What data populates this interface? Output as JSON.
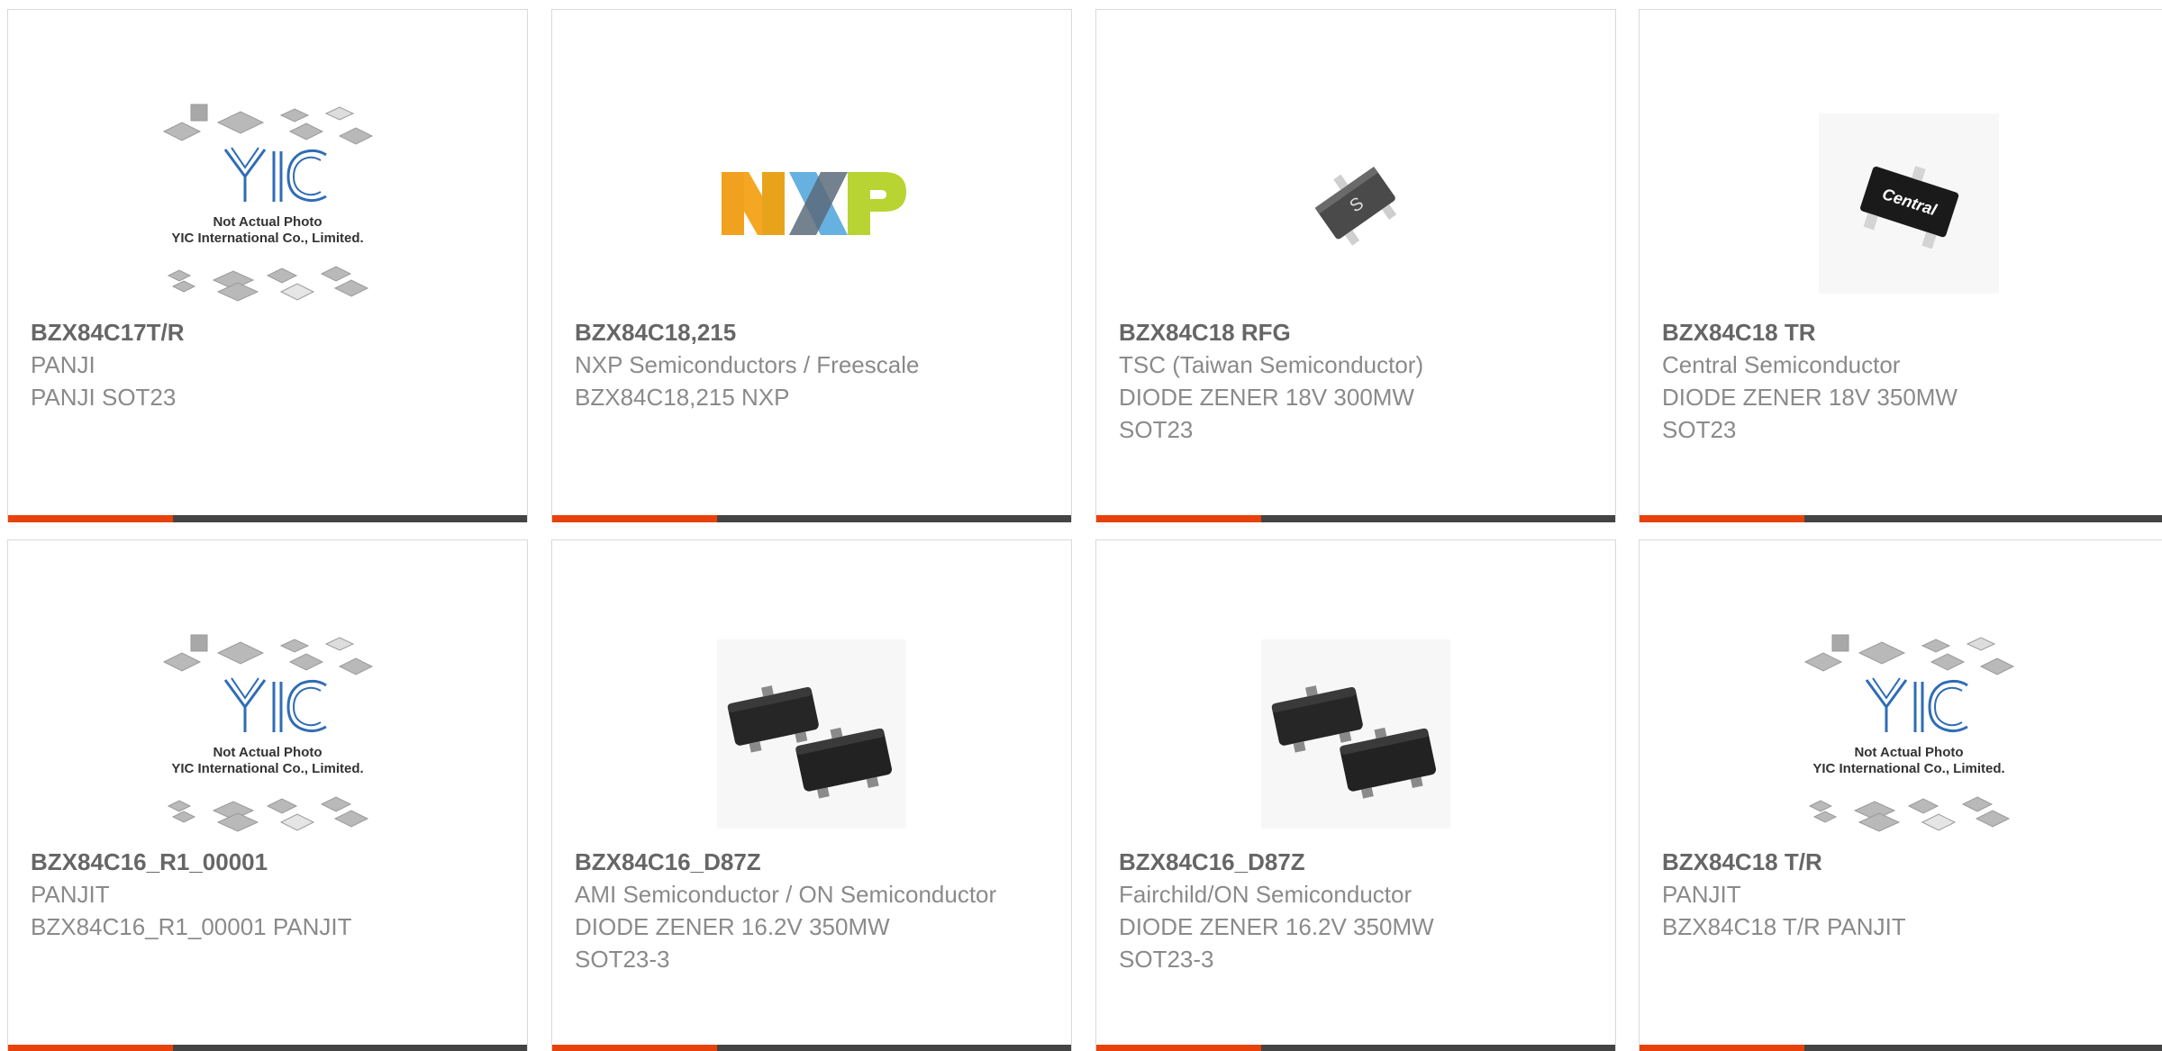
{
  "products": [
    {
      "part_number": "BZX84C17T/R",
      "manufacturer": "PANJI",
      "description_lines": [
        "PANJI SOT23"
      ],
      "image": "yic-placeholder",
      "placeholder_text": [
        "Not Actual Photo",
        "YIC International Co., Limited."
      ],
      "logo_text": "YIC"
    },
    {
      "part_number": "BZX84C18,215",
      "manufacturer": "NXP Semiconductors / Freescale",
      "description_lines": [
        "BZX84C18,215 NXP"
      ],
      "image": "nxp-logo",
      "logo_text": "NXP"
    },
    {
      "part_number": "BZX84C18 RFG",
      "manufacturer": "TSC (Taiwan Semiconductor)",
      "description_lines": [
        "DIODE ZENER 18V 300MW",
        "SOT23"
      ],
      "image": "sot23-chip-tsc",
      "marking": "S"
    },
    {
      "part_number": "BZX84C18 TR",
      "manufacturer": "Central Semiconductor",
      "description_lines": [
        "DIODE ZENER 18V 350MW",
        "SOT23"
      ],
      "image": "sot23-chip-central",
      "marking": "Central"
    },
    {
      "part_number": "BZX84C16_R1_00001",
      "manufacturer": "PANJIT",
      "description_lines": [
        "BZX84C16_R1_00001 PANJIT"
      ],
      "image": "yic-placeholder",
      "placeholder_text": [
        "Not Actual Photo",
        "YIC International Co., Limited."
      ],
      "logo_text": "YIC"
    },
    {
      "part_number": "BZX84C16_D87Z",
      "manufacturer": "AMI Semiconductor / ON Semiconductor",
      "description_lines": [
        "DIODE ZENER 16.2V 350MW",
        "SOT23-3"
      ],
      "image": "sot23-pair"
    },
    {
      "part_number": "BZX84C16_D87Z",
      "manufacturer": "Fairchild/ON Semiconductor",
      "description_lines": [
        "DIODE ZENER 16.2V 350MW",
        "SOT23-3"
      ],
      "image": "sot23-pair"
    },
    {
      "part_number": "BZX84C18 T/R",
      "manufacturer": "PANJIT",
      "description_lines": [
        "BZX84C18 T/R PANJIT"
      ],
      "image": "yic-placeholder",
      "placeholder_text": [
        "Not Actual Photo",
        "YIC International Co., Limited."
      ],
      "logo_text": "YIC"
    }
  ],
  "colors": {
    "accent": "#e8420c",
    "bar": "#444444",
    "title": "#666666",
    "text": "#8a8a8a",
    "yic_blue": "#2f6db5"
  }
}
